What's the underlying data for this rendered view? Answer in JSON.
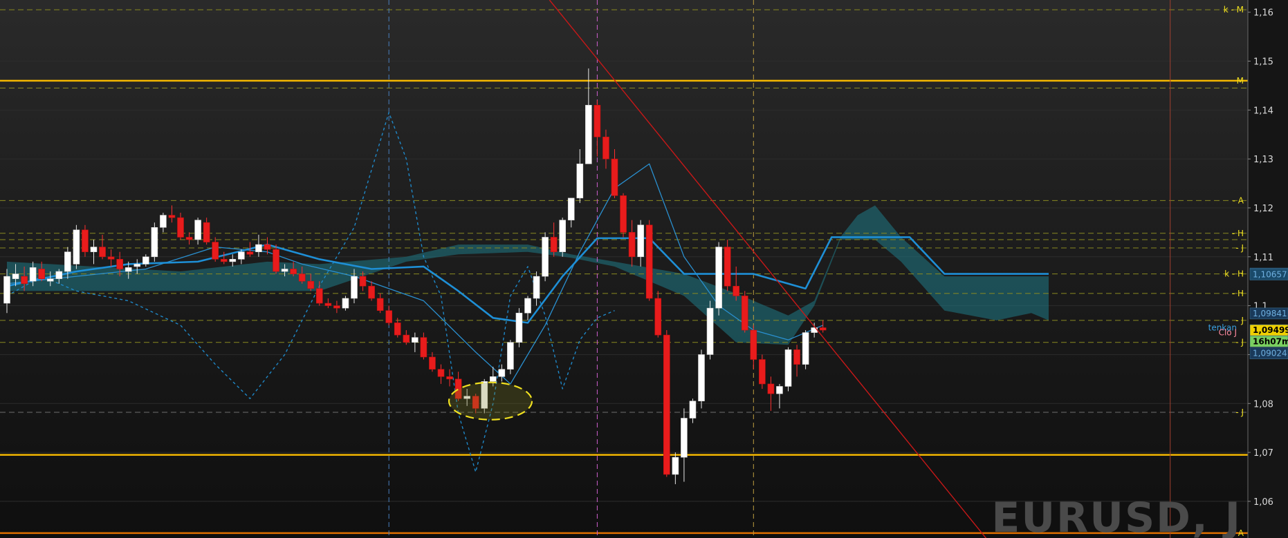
{
  "chart_data": {
    "type": "candlestick",
    "symbol_watermark": "EURUSD, J",
    "ylim": [
      1.0525,
      1.1625
    ],
    "y_ticks": [
      "1,16",
      "1,15",
      "1,14",
      "1,13",
      "1,12",
      "1,11",
      "1,1",
      "1,09",
      "1,08",
      "1,07",
      "1,06"
    ],
    "y_tick_values": [
      1.16,
      1.15,
      1.14,
      1.13,
      1.12,
      1.11,
      1.1,
      1.09,
      1.08,
      1.07,
      1.06
    ],
    "candles": [
      [
        1.1005,
        1.1075,
        1.0985,
        1.106
      ],
      [
        1.1055,
        1.1085,
        1.104,
        1.1065
      ],
      [
        1.106,
        1.108,
        1.103,
        1.1045
      ],
      [
        1.105,
        1.109,
        1.104,
        1.1078
      ],
      [
        1.1075,
        1.109,
        1.105,
        1.1055
      ],
      [
        1.105,
        1.107,
        1.104,
        1.1055
      ],
      [
        1.1055,
        1.1075,
        1.1045,
        1.107
      ],
      [
        1.107,
        1.112,
        1.1055,
        1.111
      ],
      [
        1.1085,
        1.1165,
        1.1075,
        1.1155
      ],
      [
        1.1155,
        1.1165,
        1.11,
        1.111
      ],
      [
        1.111,
        1.1135,
        1.1085,
        1.112
      ],
      [
        1.112,
        1.1145,
        1.1095,
        1.11
      ],
      [
        1.11,
        1.1115,
        1.108,
        1.1095
      ],
      [
        1.1095,
        1.111,
        1.106,
        1.1075
      ],
      [
        1.107,
        1.109,
        1.1055,
        1.1078
      ],
      [
        1.108,
        1.1095,
        1.1065,
        1.1085
      ],
      [
        1.1085,
        1.1105,
        1.108,
        1.11
      ],
      [
        1.11,
        1.117,
        1.109,
        1.116
      ],
      [
        1.116,
        1.119,
        1.115,
        1.1185
      ],
      [
        1.1185,
        1.1205,
        1.117,
        1.118
      ],
      [
        1.118,
        1.119,
        1.1135,
        1.114
      ],
      [
        1.114,
        1.115,
        1.1125,
        1.1135
      ],
      [
        1.1135,
        1.118,
        1.1125,
        1.1175
      ],
      [
        1.117,
        1.118,
        1.1125,
        1.113
      ],
      [
        1.113,
        1.114,
        1.109,
        1.1095
      ],
      [
        1.1095,
        1.111,
        1.1085,
        1.109
      ],
      [
        1.109,
        1.1105,
        1.108,
        1.1095
      ],
      [
        1.1095,
        1.1115,
        1.1085,
        1.111
      ],
      [
        1.111,
        1.113,
        1.11,
        1.1105
      ],
      [
        1.111,
        1.1145,
        1.11,
        1.1125
      ],
      [
        1.1125,
        1.114,
        1.1105,
        1.1115
      ],
      [
        1.1115,
        1.1125,
        1.1065,
        1.107
      ],
      [
        1.107,
        1.1085,
        1.106,
        1.1075
      ],
      [
        1.1075,
        1.109,
        1.106,
        1.1065
      ],
      [
        1.1065,
        1.108,
        1.1045,
        1.105
      ],
      [
        1.105,
        1.1065,
        1.103,
        1.1035
      ],
      [
        1.1035,
        1.105,
        1.1,
        1.1005
      ],
      [
        1.1005,
        1.1015,
        1.0995,
        1.1
      ],
      [
        1.1,
        1.101,
        1.0985,
        1.0995
      ],
      [
        1.0995,
        1.102,
        1.099,
        1.1015
      ],
      [
        1.1015,
        1.1075,
        1.1005,
        1.106
      ],
      [
        1.106,
        1.107,
        1.103,
        1.104
      ],
      [
        1.104,
        1.105,
        1.101,
        1.1015
      ],
      [
        1.1015,
        1.1025,
        1.0985,
        1.099
      ],
      [
        1.099,
        1.1,
        1.096,
        1.0965
      ],
      [
        1.0965,
        1.0975,
        1.0935,
        1.094
      ],
      [
        1.094,
        1.095,
        1.092,
        1.0925
      ],
      [
        1.0925,
        1.0945,
        1.0905,
        1.0935
      ],
      [
        1.0935,
        1.0945,
        1.089,
        1.0895
      ],
      [
        1.0895,
        1.0905,
        1.0865,
        1.087
      ],
      [
        1.087,
        1.088,
        1.084,
        1.0855
      ],
      [
        1.0855,
        1.087,
        1.0835,
        1.085
      ],
      [
        1.085,
        1.0865,
        1.0805,
        1.081
      ],
      [
        1.081,
        1.083,
        1.0795,
        1.0815
      ],
      [
        1.0815,
        1.082,
        1.078,
        1.079
      ],
      [
        1.079,
        1.085,
        1.078,
        1.0845
      ],
      [
        1.0845,
        1.0875,
        1.0835,
        1.0855
      ],
      [
        1.0855,
        1.088,
        1.0845,
        1.087
      ],
      [
        1.087,
        1.093,
        1.086,
        1.0925
      ],
      [
        1.0925,
        1.0995,
        1.0915,
        1.0985
      ],
      [
        1.0985,
        1.102,
        1.097,
        1.1015
      ],
      [
        1.1015,
        1.107,
        1.1,
        1.106
      ],
      [
        1.106,
        1.115,
        1.105,
        1.114
      ],
      [
        1.114,
        1.117,
        1.11,
        1.111
      ],
      [
        1.111,
        1.118,
        1.11,
        1.1175
      ],
      [
        1.1175,
        1.1215,
        1.116,
        1.122
      ],
      [
        1.122,
        1.132,
        1.121,
        1.129
      ],
      [
        1.129,
        1.1485,
        1.129,
        1.141
      ],
      [
        1.141,
        1.142,
        1.1305,
        1.1345
      ],
      [
        1.1345,
        1.136,
        1.128,
        1.13
      ],
      [
        1.13,
        1.132,
        1.122,
        1.1225
      ],
      [
        1.1225,
        1.123,
        1.114,
        1.115
      ],
      [
        1.115,
        1.1175,
        1.108,
        1.11
      ],
      [
        1.11,
        1.1175,
        1.108,
        1.1165
      ],
      [
        1.1165,
        1.1175,
        1.101,
        1.1015
      ],
      [
        1.1015,
        1.103,
        1.0935,
        1.094
      ],
      [
        1.094,
        1.095,
        1.065,
        1.0655
      ],
      [
        1.0655,
        1.07,
        1.0635,
        1.069
      ],
      [
        1.069,
        1.079,
        1.064,
        1.077
      ],
      [
        1.077,
        1.081,
        1.076,
        1.0805
      ],
      [
        1.0805,
        1.091,
        1.079,
        1.09
      ],
      [
        1.09,
        1.101,
        1.089,
        1.0995
      ],
      [
        1.0995,
        1.113,
        1.098,
        1.112
      ],
      [
        1.112,
        1.1135,
        1.103,
        1.104
      ],
      [
        1.104,
        1.108,
        1.101,
        1.102
      ],
      [
        1.102,
        1.103,
        1.0945,
        1.095
      ],
      [
        1.095,
        1.096,
        1.087,
        1.089
      ],
      [
        1.089,
        1.09,
        1.083,
        1.084
      ],
      [
        1.084,
        1.0855,
        1.0785,
        1.082
      ],
      [
        1.082,
        1.084,
        1.079,
        1.0835
      ],
      [
        1.0835,
        1.0915,
        1.0825,
        1.091
      ],
      [
        1.091,
        1.092,
        1.0855,
        1.088
      ],
      [
        1.088,
        1.095,
        1.087,
        1.0945
      ],
      [
        1.0945,
        1.0965,
        1.0935,
        1.0955
      ],
      [
        1.0955,
        1.097,
        1.0945,
        1.095
      ]
    ],
    "horizontal_levels": [
      {
        "price": 1.146,
        "color": "#f5b800",
        "style": "solid",
        "label": "M"
      },
      {
        "price": 1.0695,
        "color": "#f5b800",
        "style": "solid",
        "label": ""
      },
      {
        "price": 1.0535,
        "color": "#e07000",
        "style": "solid",
        "label": "A"
      },
      {
        "price": 1.1605,
        "color": "#8a8a20",
        "style": "dashed",
        "label": "k - M"
      },
      {
        "price": 1.1445,
        "color": "#8a8a20",
        "style": "dashed",
        "label": ""
      },
      {
        "price": 1.1215,
        "color": "#8a8a20",
        "style": "dashed",
        "label": "- A"
      },
      {
        "price": 1.1148,
        "color": "#8a8a20",
        "style": "dashed",
        "label": "- H"
      },
      {
        "price": 1.1135,
        "color": "#8a8a20",
        "style": "dashed",
        "label": ""
      },
      {
        "price": 1.1118,
        "color": "#8a8a20",
        "style": "dashed",
        "label": "- J"
      },
      {
        "price": 1.1065,
        "color": "#8a8a20",
        "style": "dashed",
        "label": "k - H"
      },
      {
        "price": 1.1025,
        "color": "#8a8a20",
        "style": "dashed",
        "label": "- H"
      },
      {
        "price": 1.097,
        "color": "#8a8a20",
        "style": "dashed",
        "label": "- J"
      },
      {
        "price": 1.0925,
        "color": "#8a8a20",
        "style": "dashed",
        "label": "- J"
      },
      {
        "price": 1.0782,
        "color": "#707070",
        "style": "dashed",
        "label": "- J"
      }
    ],
    "price_tags": [
      {
        "text": "1,10657",
        "price": 1.10657,
        "bg": "#1a4a6a",
        "fg": "#6fb0e0"
      },
      {
        "text": "1,10657",
        "price": 1.10637,
        "bg": "#1a4a6a",
        "fg": "#6fb0e0"
      },
      {
        "text": "1,09841",
        "price": 1.09841,
        "bg": "#1a3a5a",
        "fg": "#6fb0e0"
      },
      {
        "text": "1,09499",
        "price": 1.09499,
        "bg": "#f0d000",
        "fg": "#000000"
      },
      {
        "text": "16h07m",
        "price": 1.09269,
        "bg": "#7ad060",
        "fg": "#000000"
      },
      {
        "text": "1,09024",
        "price": 1.09024,
        "bg": "#1a3a5a",
        "fg": "#6fb0e0"
      }
    ],
    "inline_labels": [
      {
        "text": "tenkan",
        "price": 1.0955,
        "color": "#3aa0e0"
      },
      {
        "text": "Clo J",
        "price": 1.0945,
        "color": "#ff8aa0"
      }
    ],
    "vertical_markers": [
      {
        "candle": 44,
        "color": "#4a80c0"
      },
      {
        "candle": 68,
        "color": "#d060d0"
      },
      {
        "candle": 86,
        "color": "#c0a040"
      },
      {
        "candle": 134,
        "color": "#a04030"
      }
    ],
    "trendline": [
      [
        62.5,
        1.1625
      ],
      [
        113,
        1.052
      ]
    ],
    "tenkan": [
      [
        0,
        1.1045
      ],
      [
        8,
        1.106
      ],
      [
        16,
        1.1075
      ],
      [
        24,
        1.112
      ],
      [
        30,
        1.111
      ],
      [
        34,
        1.1085
      ],
      [
        40,
        1.106
      ],
      [
        48,
        1.101
      ],
      [
        54,
        1.0905
      ],
      [
        58,
        1.084
      ],
      [
        62,
        1.096
      ],
      [
        66,
        1.111
      ],
      [
        70,
        1.124
      ],
      [
        74,
        1.129
      ],
      [
        78,
        1.11
      ],
      [
        82,
        1.1
      ],
      [
        86,
        1.095
      ],
      [
        90,
        1.093
      ],
      [
        94,
        1.096
      ]
    ],
    "kijun": [
      [
        0,
        1.104
      ],
      [
        8,
        1.107
      ],
      [
        14,
        1.1085
      ],
      [
        22,
        1.109
      ],
      [
        30,
        1.1125
      ],
      [
        36,
        1.1095
      ],
      [
        42,
        1.1075
      ],
      [
        48,
        1.108
      ],
      [
        52,
        1.103
      ],
      [
        56,
        1.0975
      ],
      [
        60,
        1.0965
      ],
      [
        64,
        1.106
      ],
      [
        68,
        1.1138
      ],
      [
        74,
        1.1138
      ],
      [
        78,
        1.1065
      ],
      [
        86,
        1.1065
      ],
      [
        92,
        1.1035
      ],
      [
        95,
        1.114
      ],
      [
        104,
        1.114
      ],
      [
        108,
        1.1065
      ],
      [
        120,
        1.1065
      ]
    ],
    "cloud_upper": [
      [
        0,
        1.109
      ],
      [
        10,
        1.108
      ],
      [
        20,
        1.107
      ],
      [
        30,
        1.109
      ],
      [
        36,
        1.1085
      ],
      [
        46,
        1.11
      ],
      [
        52,
        1.1125
      ],
      [
        60,
        1.1125
      ],
      [
        65,
        1.1105
      ],
      [
        70,
        1.109
      ],
      [
        78,
        1.1065
      ],
      [
        84,
        1.1025
      ],
      [
        90,
        1.098
      ],
      [
        93,
        1.101
      ],
      [
        96,
        1.114
      ],
      [
        98,
        1.1185
      ],
      [
        100,
        1.1205
      ],
      [
        103,
        1.114
      ],
      [
        108,
        1.106
      ],
      [
        120,
        1.106
      ]
    ],
    "cloud_lower": [
      [
        0,
        1.103
      ],
      [
        10,
        1.103
      ],
      [
        20,
        1.103
      ],
      [
        30,
        1.103
      ],
      [
        36,
        1.103
      ],
      [
        46,
        1.109
      ],
      [
        52,
        1.1105
      ],
      [
        60,
        1.111
      ],
      [
        65,
        1.1098
      ],
      [
        70,
        1.108
      ],
      [
        78,
        1.102
      ],
      [
        84,
        1.0925
      ],
      [
        90,
        1.092
      ],
      [
        93,
        1.1
      ],
      [
        96,
        1.1135
      ],
      [
        100,
        1.1135
      ],
      [
        103,
        1.109
      ],
      [
        108,
        1.099
      ],
      [
        114,
        1.097
      ],
      [
        118,
        1.0985
      ],
      [
        120,
        1.097
      ]
    ],
    "chikou": [
      [
        0,
        1.102
      ],
      [
        4,
        1.106
      ],
      [
        8,
        1.103
      ],
      [
        14,
        1.101
      ],
      [
        20,
        1.096
      ],
      [
        24,
        1.088
      ],
      [
        28,
        1.081
      ],
      [
        32,
        1.09
      ],
      [
        36,
        1.104
      ],
      [
        40,
        1.116
      ],
      [
        44,
        1.1395
      ],
      [
        46,
        1.13
      ],
      [
        48,
        1.11
      ],
      [
        50,
        1.102
      ],
      [
        52,
        1.078
      ],
      [
        54,
        1.066
      ],
      [
        56,
        1.08
      ],
      [
        58,
        1.102
      ],
      [
        60,
        1.108
      ],
      [
        62,
        1.098
      ],
      [
        64,
        1.083
      ],
      [
        66,
        1.093
      ],
      [
        68,
        1.0975
      ],
      [
        70,
        1.099
      ]
    ]
  }
}
